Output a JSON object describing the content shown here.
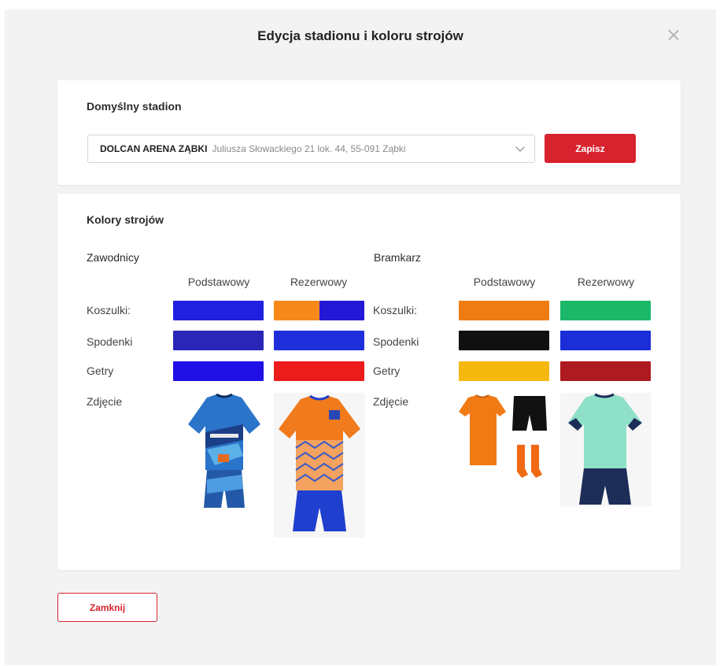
{
  "modal": {
    "title": "Edycja stadionu i koloru strojów",
    "close_icon": "close-icon",
    "close_button_label": "Zamknij"
  },
  "stadium": {
    "section_title": "Domyślny stadion",
    "selected_name": "DOLCAN ARENA ZĄBKI",
    "selected_address": "Juliusza Słowackiego 21 lok. 44, 55-091 Ząbki",
    "dropdown_icon": "chevron-down-icon",
    "save_label": "Zapisz"
  },
  "kits": {
    "section_title": "Kolory strojów",
    "row_labels": {
      "shirts": "Koszulki:",
      "shorts": "Spodenki",
      "socks": "Getry",
      "photo": "Zdjęcie"
    },
    "players": {
      "title": "Zawodnicy",
      "primary": {
        "header": "Podstawowy",
        "shirts": [
          "#1f20e0"
        ],
        "shorts": "#2a27b8",
        "socks": "#2010e6"
      },
      "reserve": {
        "header": "Rezerwowy",
        "shirts": [
          "#f7891b",
          "#2418d6"
        ],
        "shorts": "#1f2fdc",
        "socks": "#ec1c1c"
      }
    },
    "goalkeeper": {
      "title": "Bramkarz",
      "primary": {
        "header": "Podstawowy",
        "shirts": [
          "#ef7c12"
        ],
        "shorts": "#101010",
        "socks": "#f5b80e"
      },
      "reserve": {
        "header": "Rezerwowy",
        "shirts": [
          "#1cb86a"
        ],
        "shorts": "#1b2ed8",
        "socks": "#ad1a1f"
      }
    }
  },
  "colors": {
    "accent": "#d8232f",
    "modal_bg": "#f3f3f4",
    "card_bg": "#ffffff"
  }
}
